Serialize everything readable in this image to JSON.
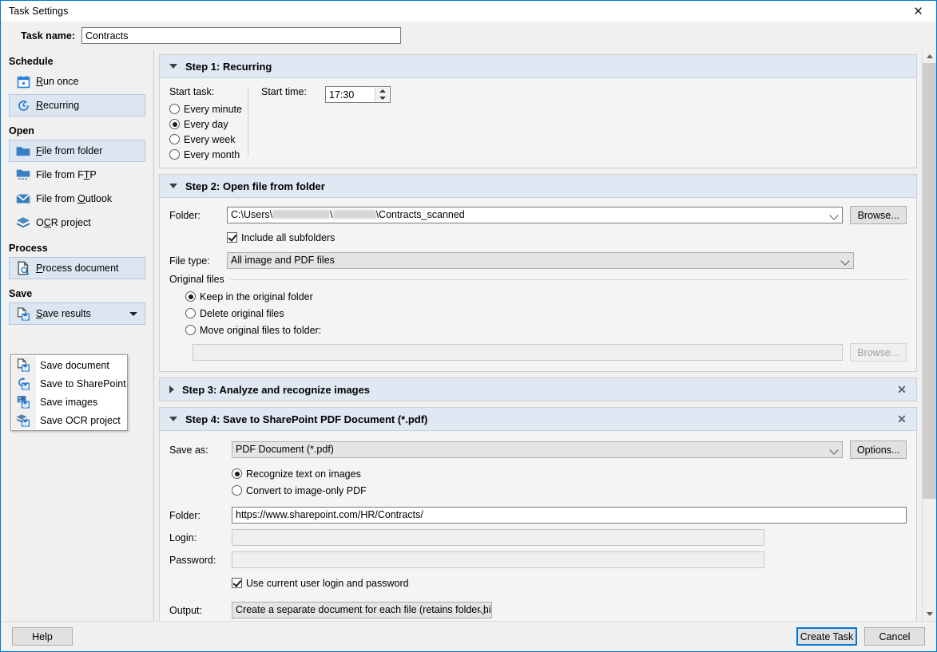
{
  "window": {
    "title": "Task Settings",
    "close_icon": "close-icon"
  },
  "task_name": {
    "label": "Task name:",
    "value": "Contracts",
    "placeholder": ""
  },
  "sidebar": {
    "groups": [
      {
        "title": "Schedule",
        "items": [
          {
            "label": "Run once",
            "accel": "R",
            "icon": "calendar-icon",
            "selected": false
          },
          {
            "label": "Recurring",
            "accel": "R",
            "icon": "recurring-clock-icon",
            "selected": true
          }
        ]
      },
      {
        "title": "Open",
        "items": [
          {
            "label": "File from folder",
            "accel": "F",
            "icon": "folder-icon",
            "selected": true
          },
          {
            "label": "File from FTP",
            "accel": "T",
            "icon": "ftp-folder-icon",
            "selected": false
          },
          {
            "label": "File from Outlook",
            "accel": "O",
            "icon": "mail-envelope-icon",
            "selected": false
          },
          {
            "label": "OCR project",
            "accel": "C",
            "icon": "layers-icon",
            "selected": false
          }
        ]
      },
      {
        "title": "Process",
        "items": [
          {
            "label": "Process document",
            "accel": "P",
            "icon": "document-scan-icon",
            "selected": true
          }
        ]
      },
      {
        "title": "Save",
        "split_button": {
          "label": "Save results",
          "accel": "S",
          "icon": "save-document-icon",
          "caret": "chevron-down-icon"
        },
        "menu": [
          {
            "label": "Save document",
            "icon": "save-document-icon"
          },
          {
            "label": "Save to SharePoint",
            "icon": "save-sharepoint-icon"
          },
          {
            "label": "Save images",
            "icon": "save-images-icon"
          },
          {
            "label": "Save OCR project",
            "icon": "save-ocr-project-icon"
          }
        ]
      }
    ]
  },
  "steps": [
    {
      "id": "step1",
      "title": "Step 1: Recurring",
      "expanded": true,
      "closable": false,
      "start_task": {
        "label": "Start task:",
        "options": [
          "Every minute",
          "Every day",
          "Every week",
          "Every month"
        ],
        "selected": "Every day"
      },
      "start_time": {
        "label": "Start time:",
        "value": "17:30"
      }
    },
    {
      "id": "step2",
      "title": "Step 2: Open file from folder",
      "expanded": true,
      "closable": false,
      "folder": {
        "label": "Folder:",
        "value_prefix": "C:\\Users\\",
        "redacted_1_width": 72,
        "value_mid": "\\",
        "redacted_2_width": 54,
        "value_suffix": "\\Contracts_scanned",
        "browse_label": "Browse..."
      },
      "include_subfolders": {
        "label": "Include all subfolders",
        "checked": true
      },
      "file_type": {
        "label": "File type:",
        "value": "All image and PDF files"
      },
      "original_files": {
        "legend": "Original files",
        "options": [
          "Keep in the original folder",
          "Delete original files",
          "Move original files to folder:"
        ],
        "selected": "Keep in the original folder",
        "move_path_value": "",
        "move_browse_label": "Browse...",
        "move_browse_disabled": true
      }
    },
    {
      "id": "step3",
      "title": "Step 3: Analyze and recognize images",
      "expanded": false,
      "closable": true
    },
    {
      "id": "step4",
      "title": "Step 4: Save to SharePoint PDF Document (*.pdf)",
      "expanded": true,
      "closable": true,
      "save_as": {
        "label": "Save as:",
        "value": "PDF Document (*.pdf)",
        "options_label": "Options..."
      },
      "pdf_mode": {
        "options": [
          "Recognize text on images",
          "Convert to image-only PDF"
        ],
        "selected": "Recognize text on images"
      },
      "folder": {
        "label": "Folder:",
        "value": "https://www.sharepoint.com/HR/Contracts/"
      },
      "login": {
        "label": "Login:",
        "value": ""
      },
      "password": {
        "label": "Password:",
        "value": ""
      },
      "use_current_user": {
        "label": "Use current user login and password",
        "checked": true
      },
      "output": {
        "label": "Output:",
        "value": "Create a separate document for each file (retains folder hierar"
      }
    }
  ],
  "footer": {
    "help_label": "Help",
    "create_label": "Create Task",
    "cancel_label": "Cancel"
  },
  "scrollbar": {
    "up_icon": "scroll-up-icon",
    "down_icon": "scroll-down-icon"
  }
}
